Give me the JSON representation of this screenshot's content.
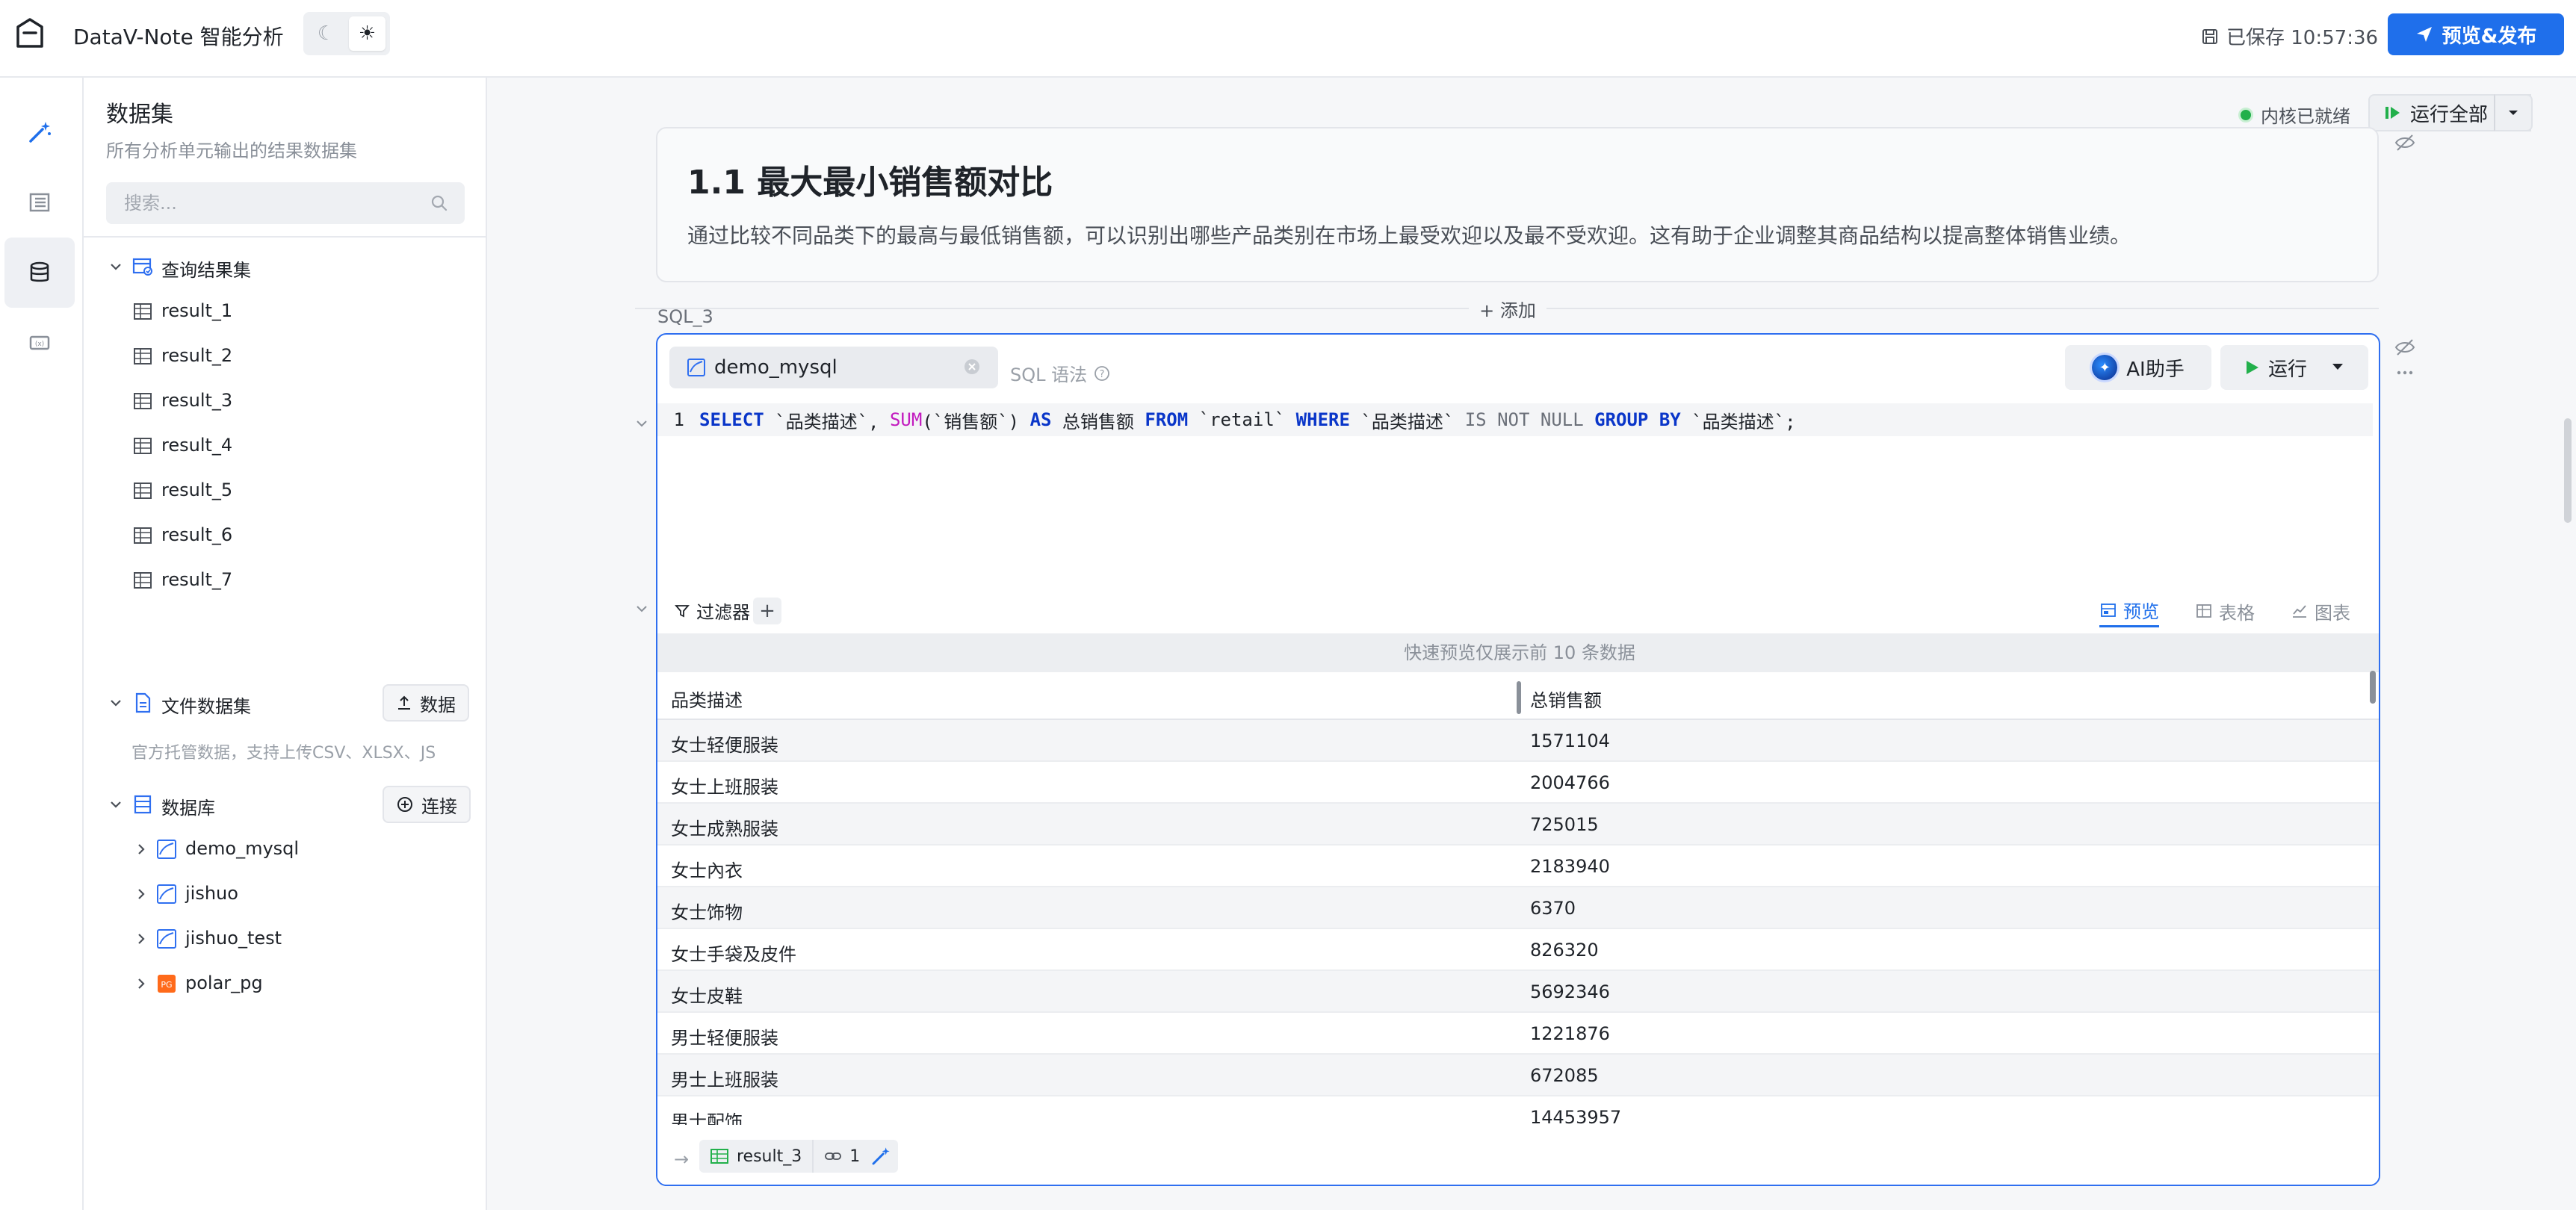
{
  "header": {
    "app_title": "DataV-Note 智能分析",
    "saved_text": "已保存 10:57:36",
    "publish_label": "预览&发布",
    "theme_dark_icon": "moon-icon",
    "theme_light_icon": "sun-icon"
  },
  "rail": {
    "items": [
      {
        "icon": "magic-wand-icon",
        "active": false
      },
      {
        "icon": "outline-icon",
        "active": false
      },
      {
        "icon": "database-icon",
        "active": true
      },
      {
        "icon": "variable-icon",
        "active": false
      }
    ]
  },
  "dataset_panel": {
    "title": "数据集",
    "subtitle": "所有分析单元输出的结果数据集",
    "search_placeholder": "搜索...",
    "query_results": {
      "label": "查询结果集",
      "items": [
        "result_1",
        "result_2",
        "result_3",
        "result_4",
        "result_5",
        "result_6",
        "result_7"
      ]
    },
    "file_datasets": {
      "label": "文件数据集",
      "button_label": "数据",
      "note": "官方托管数据，支持上传CSV、XLSX、JS"
    },
    "databases": {
      "label": "数据库",
      "button_label": "连接",
      "items": [
        {
          "name": "demo_mysql",
          "type": "mysql"
        },
        {
          "name": "jishuo",
          "type": "mysql"
        },
        {
          "name": "jishuo_test",
          "type": "mysql"
        },
        {
          "name": "polar_pg",
          "type": "pg"
        }
      ]
    }
  },
  "kernel": {
    "status": "内核已就绪",
    "run_all_label": "运行全部"
  },
  "markdown_cell": {
    "title": "1.1 最大最小销售额对比",
    "body": "通过比较不同品类下的最高与最低销售额，可以识别出哪些产品类别在市场上最受欢迎以及最不受欢迎。这有助于企业调整其商品结构以提高整体销售业绩。"
  },
  "add_label": "+ 添加",
  "sql_cell": {
    "label": "SQL_3",
    "datasource": "demo_mysql",
    "syntax_hint": "SQL 语法",
    "ai_label": "AI助手",
    "run_label": "运行",
    "line_number": "1",
    "sql": {
      "k_select": "SELECT",
      "t1": " `品类描述`, ",
      "f_sum": "SUM",
      "t2": "(`销售额`) ",
      "k_as": "AS",
      "t3": " 总销售额 ",
      "k_from": "FROM",
      "t4": " `retail` ",
      "k_where": "WHERE",
      "t5": " `品类描述` ",
      "n_isnotnull": "IS NOT NULL",
      "t6": " ",
      "k_groupby": "GROUP BY",
      "t7": " `品类描述`;"
    },
    "filter_label": "过滤器",
    "filter_add": "+",
    "view_tabs": [
      {
        "label": "预览",
        "icon": "preview-icon",
        "active": true
      },
      {
        "label": "表格",
        "icon": "table-icon",
        "active": false
      },
      {
        "label": "图表",
        "icon": "chart-icon",
        "active": false
      }
    ],
    "preview_note": "快速预览仅展示前 10 条数据",
    "columns": [
      "品类描述",
      "总销售额"
    ],
    "rows": [
      [
        "女士轻便服装",
        "1571104"
      ],
      [
        "女士上班服装",
        "2004766"
      ],
      [
        "女士成熟服装",
        "725015"
      ],
      [
        "女士內衣",
        "2183940"
      ],
      [
        "女士饰物",
        "6370"
      ],
      [
        "女士手袋及皮件",
        "826320"
      ],
      [
        "女士皮鞋",
        "5692346"
      ],
      [
        "男士轻便服装",
        "1221876"
      ],
      [
        "男士上班服装",
        "672085"
      ],
      [
        "男士配饰",
        "14453957"
      ]
    ],
    "output_name": "result_3",
    "output_link_count": "1"
  }
}
